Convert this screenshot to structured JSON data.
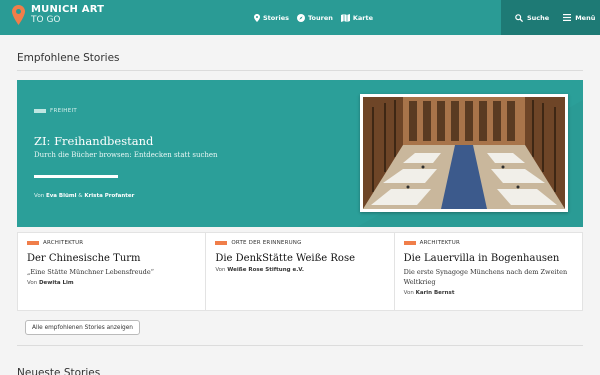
{
  "header": {
    "logo_line1": "MUNICH ART",
    "logo_line2": "TO GO",
    "nav": [
      {
        "label": "Stories",
        "icon": "map-pin-icon"
      },
      {
        "label": "Touren",
        "icon": "compass-icon"
      },
      {
        "label": "Karte",
        "icon": "map-icon"
      }
    ],
    "search_label": "Suche",
    "menu_label": "Menü",
    "colors": {
      "bar": "#2a9b95",
      "dark": "#1e7a75",
      "accent": "#f07e4a"
    }
  },
  "featured": {
    "section_title": "Empfohlene Stories",
    "tag": "FREIHEIT",
    "title": "ZI: Freihandbestand",
    "subtitle": "Durch die Bücher browsen: Entdecken statt suchen",
    "progress": 1.0,
    "byline_prefix": "Von",
    "author1": "Eva Blüml",
    "byline_joiner": "&",
    "author2": "Krista Profanter"
  },
  "cards": [
    {
      "tag": "ARCHITEKTUR",
      "title": "Der Chinesische Turm",
      "subtitle": "„Eine Stätte Münchner Lebensfreude“",
      "by_prefix": "Von",
      "author": "Dewita Lim"
    },
    {
      "tag": "ORTE DER ERINNERUNG",
      "title": "Die DenkStätte Weiße Rose",
      "subtitle": "",
      "by_prefix": "Von",
      "author": "Weiße Rose Stiftung e.V."
    },
    {
      "tag": "ARCHITEKTUR",
      "title": "Die Lauervilla in Bogenhausen",
      "subtitle": "Die erste Synagoge Münchens nach dem Zweiten Weltkrieg",
      "by_prefix": "Von",
      "author": "Karin Bernst"
    }
  ],
  "all_button": "Alle empfohlenen Stories anzeigen",
  "next_section_title": "Neueste Stories"
}
